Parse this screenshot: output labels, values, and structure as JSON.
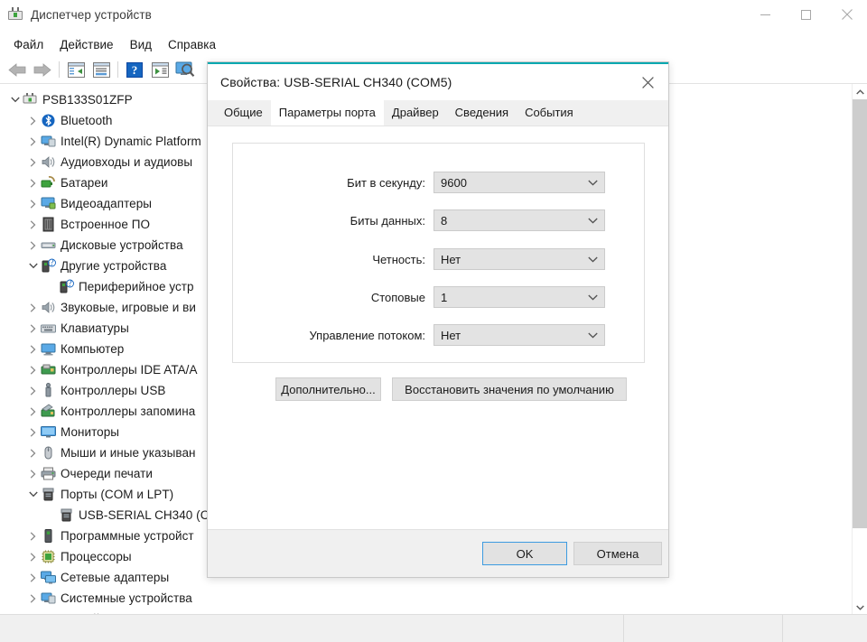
{
  "window": {
    "title": "Диспетчер устройств",
    "icon": "device-manager-icon",
    "controls": {
      "minimize": "—",
      "maximize": "□",
      "close": "✕"
    }
  },
  "menubar": {
    "items": [
      {
        "label": "Файл"
      },
      {
        "label": "Действие"
      },
      {
        "label": "Вид"
      },
      {
        "label": "Справка"
      }
    ]
  },
  "toolbar": {
    "buttons": [
      {
        "name": "back-arrow-icon",
        "label": ""
      },
      {
        "name": "forward-arrow-icon",
        "label": ""
      },
      {
        "name": "show-hide-console-tree-icon",
        "label": ""
      },
      {
        "name": "properties-icon",
        "label": ""
      },
      {
        "name": "help-icon",
        "label": ""
      },
      {
        "name": "scan-hardware-changes-icon",
        "label": ""
      },
      {
        "name": "update-driver-icon",
        "label": ""
      }
    ]
  },
  "tree": {
    "root": {
      "label": "PSB133S01ZFP",
      "expanded": true,
      "icon": "computer-node-icon"
    },
    "items": [
      {
        "label": "Bluetooth",
        "icon": "bluetooth-icon",
        "expandable": true,
        "expanded": false,
        "indent": 1
      },
      {
        "label": "Intel(R) Dynamic Platform",
        "icon": "system-device-icon",
        "expandable": true,
        "expanded": false,
        "indent": 1
      },
      {
        "label": "Аудиовходы и аудиовы",
        "icon": "audio-icon",
        "expandable": true,
        "expanded": false,
        "indent": 1
      },
      {
        "label": "Батареи",
        "icon": "battery-icon",
        "expandable": true,
        "expanded": false,
        "indent": 1
      },
      {
        "label": "Видеоадаптеры",
        "icon": "display-adapter-icon",
        "expandable": true,
        "expanded": false,
        "indent": 1
      },
      {
        "label": "Встроенное ПО",
        "icon": "firmware-icon",
        "expandable": true,
        "expanded": false,
        "indent": 1
      },
      {
        "label": "Дисковые устройства",
        "icon": "disk-drive-icon",
        "expandable": true,
        "expanded": false,
        "indent": 1
      },
      {
        "label": "Другие устройства",
        "icon": "unknown-device-icon",
        "expandable": true,
        "expanded": true,
        "indent": 1
      },
      {
        "label": "Периферийное устр",
        "icon": "unknown-device-icon",
        "expandable": false,
        "expanded": false,
        "indent": 2
      },
      {
        "label": "Звуковые, игровые и ви",
        "icon": "audio-icon",
        "expandable": true,
        "expanded": false,
        "indent": 1
      },
      {
        "label": "Клавиатуры",
        "icon": "keyboard-icon",
        "expandable": true,
        "expanded": false,
        "indent": 1
      },
      {
        "label": "Компьютер",
        "icon": "computer-icon",
        "expandable": true,
        "expanded": false,
        "indent": 1
      },
      {
        "label": "Контроллеры IDE ATA/A",
        "icon": "ide-controller-icon",
        "expandable": true,
        "expanded": false,
        "indent": 1
      },
      {
        "label": "Контроллеры USB",
        "icon": "usb-controller-icon",
        "expandable": true,
        "expanded": false,
        "indent": 1
      },
      {
        "label": "Контроллеры запомина",
        "icon": "storage-controller-icon",
        "expandable": true,
        "expanded": false,
        "indent": 1
      },
      {
        "label": "Мониторы",
        "icon": "monitor-icon",
        "expandable": true,
        "expanded": false,
        "indent": 1
      },
      {
        "label": "Мыши и иные указыван",
        "icon": "mouse-icon",
        "expandable": true,
        "expanded": false,
        "indent": 1
      },
      {
        "label": "Очереди печати",
        "icon": "printer-icon",
        "expandable": true,
        "expanded": false,
        "indent": 1
      },
      {
        "label": "Порты (COM и LPT)",
        "icon": "port-icon",
        "expandable": true,
        "expanded": true,
        "indent": 1
      },
      {
        "label": "USB-SERIAL CH340 (C",
        "icon": "port-icon",
        "expandable": false,
        "expanded": false,
        "indent": 2
      },
      {
        "label": "Программные устройст",
        "icon": "software-device-icon",
        "expandable": true,
        "expanded": false,
        "indent": 1
      },
      {
        "label": "Процессоры",
        "icon": "processor-icon",
        "expandable": true,
        "expanded": false,
        "indent": 1
      },
      {
        "label": "Сетевые адаптеры",
        "icon": "network-adapter-icon",
        "expandable": true,
        "expanded": false,
        "indent": 1
      },
      {
        "label": "Системные устройства",
        "icon": "system-device-icon",
        "expandable": true,
        "expanded": false,
        "indent": 1
      },
      {
        "label": "Устройства HID (Human Interface Devices)",
        "icon": "hid-icon",
        "expandable": true,
        "expanded": false,
        "indent": 1
      }
    ]
  },
  "dialog": {
    "title": "Свойства: USB-SERIAL CH340 (COM5)",
    "close_icon": "close-icon",
    "accent_color": "#00a8b0",
    "tabs": [
      {
        "label": "Общие",
        "active": false
      },
      {
        "label": "Параметры порта",
        "active": true
      },
      {
        "label": "Драйвер",
        "active": false
      },
      {
        "label": "Сведения",
        "active": false
      },
      {
        "label": "События",
        "active": false
      }
    ],
    "fields": [
      {
        "label": "Бит в секунду:",
        "value": "9600"
      },
      {
        "label": "Биты данных:",
        "value": "8"
      },
      {
        "label": "Четность:",
        "value": "Нет"
      },
      {
        "label": "Стоповые",
        "value": "1"
      },
      {
        "label": "Управление потоком:",
        "value": "Нет"
      }
    ],
    "buttons": {
      "advanced": "Дополнительно...",
      "restore": "Восстановить значения по умолчанию",
      "ok": "OK",
      "cancel": "Отмена"
    }
  },
  "scrollbar": {
    "up_icon": "chevron-up-icon",
    "down_icon": "chevron-down-icon"
  }
}
